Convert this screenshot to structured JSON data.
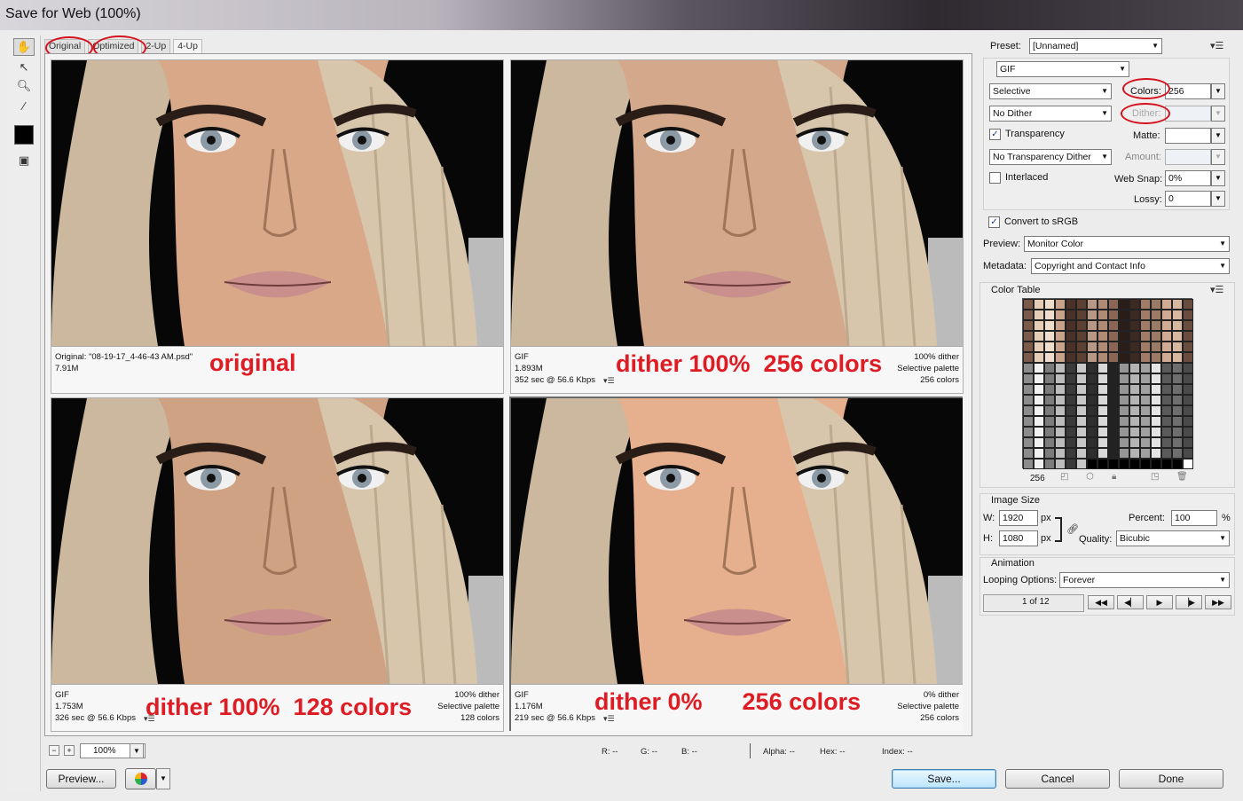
{
  "window": {
    "title": "Save for Web (100%)"
  },
  "tabs": [
    "Original",
    "Optimized",
    "2-Up",
    "4-Up"
  ],
  "panes": [
    {
      "left_lines": [
        "Original: \"08-19-17_4-46-43 AM.psd\"",
        "7.91M"
      ],
      "right_lines": [],
      "annotation": "original",
      "skin": "#d9a888"
    },
    {
      "left_lines": [
        "GIF",
        "1.893M",
        "352 sec @ 56.6 Kbps"
      ],
      "right_lines": [
        "100% dither",
        "Selective palette",
        "256 colors"
      ],
      "annotation": "dither 100%  256 colors",
      "skin": "#d4a88b"
    },
    {
      "left_lines": [
        "GIF",
        "1.753M",
        "326 sec @ 56.6 Kbps"
      ],
      "right_lines": [
        "100% dither",
        "Selective palette",
        "128 colors"
      ],
      "annotation": "dither 100%  128 colors",
      "skin": "#cfa284"
    },
    {
      "left_lines": [
        "GIF",
        "1.176M",
        "219 sec @ 56.6 Kbps"
      ],
      "right_lines": [
        "0% dither",
        "Selective palette",
        "256 colors"
      ],
      "annotation": "dither 0%      256 colors",
      "skin": "#e6b08e"
    }
  ],
  "bottom": {
    "zoom": "100%",
    "readouts": {
      "r": "R: --",
      "g": "G: --",
      "b": "B: --",
      "alpha": "Alpha: --",
      "hex": "Hex: --",
      "index": "Index: --"
    }
  },
  "buttons": {
    "preview": "Preview...",
    "save": "Save...",
    "cancel": "Cancel",
    "done": "Done"
  },
  "settings": {
    "preset_label": "Preset:",
    "preset_value": "[Unnamed]",
    "format": "GIF",
    "reduction": "Selective",
    "colors_label": "Colors:",
    "colors_value": "256",
    "dither_algo": "No Dither",
    "dither_label": "Dither:",
    "transparency_label": "Transparency",
    "transparency_checked": true,
    "matte_label": "Matte:",
    "trans_dither": "No Transparency Dither",
    "amount_label": "Amount:",
    "interlaced_label": "Interlaced",
    "interlaced_checked": false,
    "websnap_label": "Web Snap:",
    "websnap_value": "0%",
    "lossy_label": "Lossy:",
    "lossy_value": "0",
    "srgb_label": "Convert to sRGB",
    "srgb_checked": true,
    "preview_label": "Preview:",
    "preview_value": "Monitor Color",
    "metadata_label": "Metadata:",
    "metadata_value": "Copyright and Contact Info"
  },
  "color_table": {
    "title": "Color Table",
    "count": "256"
  },
  "image_size": {
    "title": "Image Size",
    "w_label": "W:",
    "w_value": "1920",
    "h_label": "H:",
    "h_value": "1080",
    "unit": "px",
    "percent_label": "Percent:",
    "percent_value": "100",
    "percent_unit": "%",
    "quality_label": "Quality:",
    "quality_value": "Bicubic"
  },
  "animation": {
    "title": "Animation",
    "looping_label": "Looping Options:",
    "looping_value": "Forever",
    "frame": "1 of 12"
  }
}
